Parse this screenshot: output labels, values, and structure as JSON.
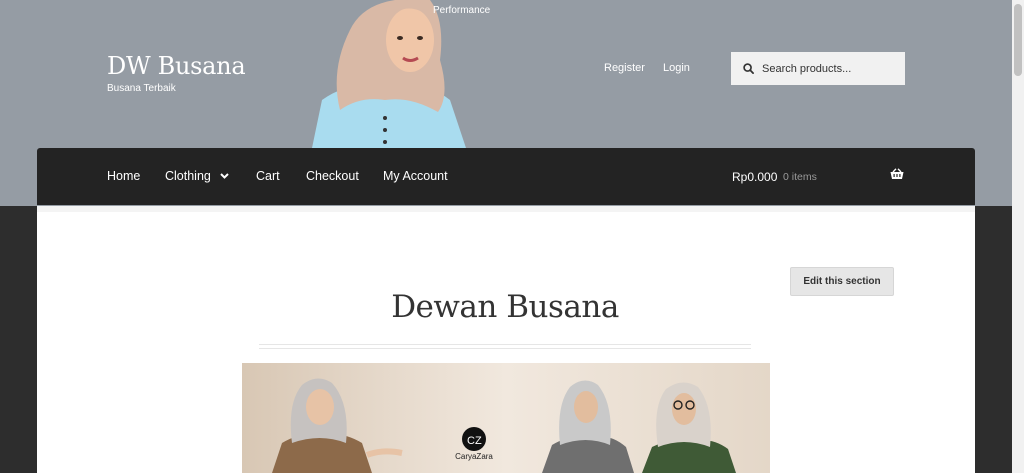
{
  "header": {
    "top_link": "Performance",
    "site_title": "DW Busana",
    "tagline": "Busana Terbaik",
    "register": "Register",
    "login": "Login",
    "search_placeholder": "Search products..."
  },
  "nav": {
    "items": [
      "Home",
      "Clothing",
      "Cart",
      "Checkout",
      "My Account"
    ],
    "cart_total": "Rp0.000",
    "cart_count": "0 items"
  },
  "content": {
    "edit_button": "Edit this section",
    "page_title": "Dewan Busana",
    "banner_brand": "CaryaZara"
  },
  "colors": {
    "header_bg": "#959ca4",
    "nav_bg": "#232323",
    "page_bg": "#2d2d2d"
  },
  "icons": {
    "search": "search-icon",
    "dropdown": "chevron-down-icon",
    "basket": "basket-icon"
  }
}
